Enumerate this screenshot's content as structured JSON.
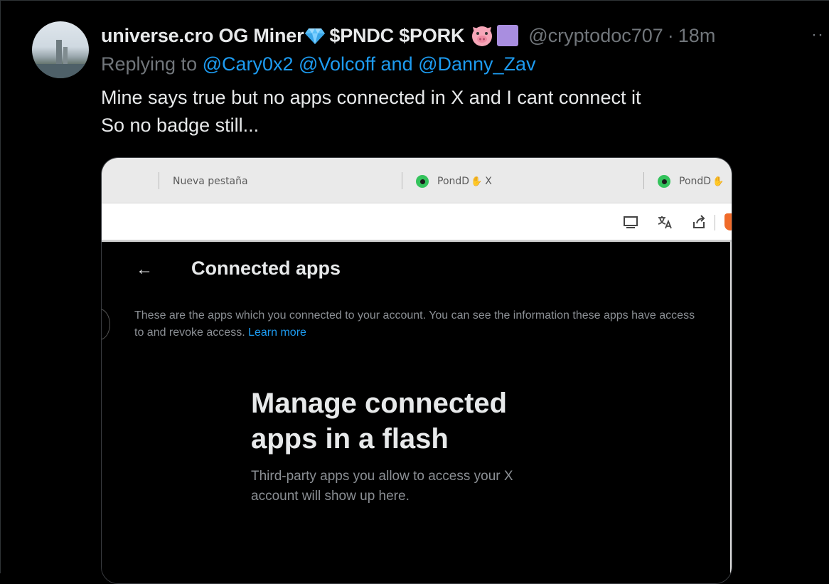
{
  "tweet": {
    "display_name": "universe.cro OG Miner",
    "tokens": "$PNDC $PORK",
    "handle": "@cryptodoc707",
    "separator": "·",
    "time": "18m",
    "more": "··",
    "replying_prefix": "Replying to",
    "mentions": "@Cary0x2 @Volcoff and @Danny_Zav",
    "text": "Mine says true but no apps connected in X and I cant connect it\nSo no badge still..."
  },
  "media": {
    "tabs": [
      {
        "label": "Nueva pestaña"
      },
      {
        "label": "PondD",
        "close": "X"
      },
      {
        "label": "PondD"
      }
    ],
    "toolbar_icons": [
      "monitor-download-icon",
      "translate-icon",
      "share-icon"
    ],
    "page_title": "Connected apps",
    "back_symbol": "←",
    "description": "These are the apps which you connected to your account. You can see the information these apps have access to and revoke access.",
    "learn_more": "Learn more",
    "empty_title": "Manage connected\napps in a flash",
    "empty_subtitle": "Third-party apps you allow to access your X\naccount will show up here."
  },
  "colors": {
    "background": "#000000",
    "text": "#e7e9ea",
    "muted": "#71767b",
    "link": "#1d9bf0"
  }
}
